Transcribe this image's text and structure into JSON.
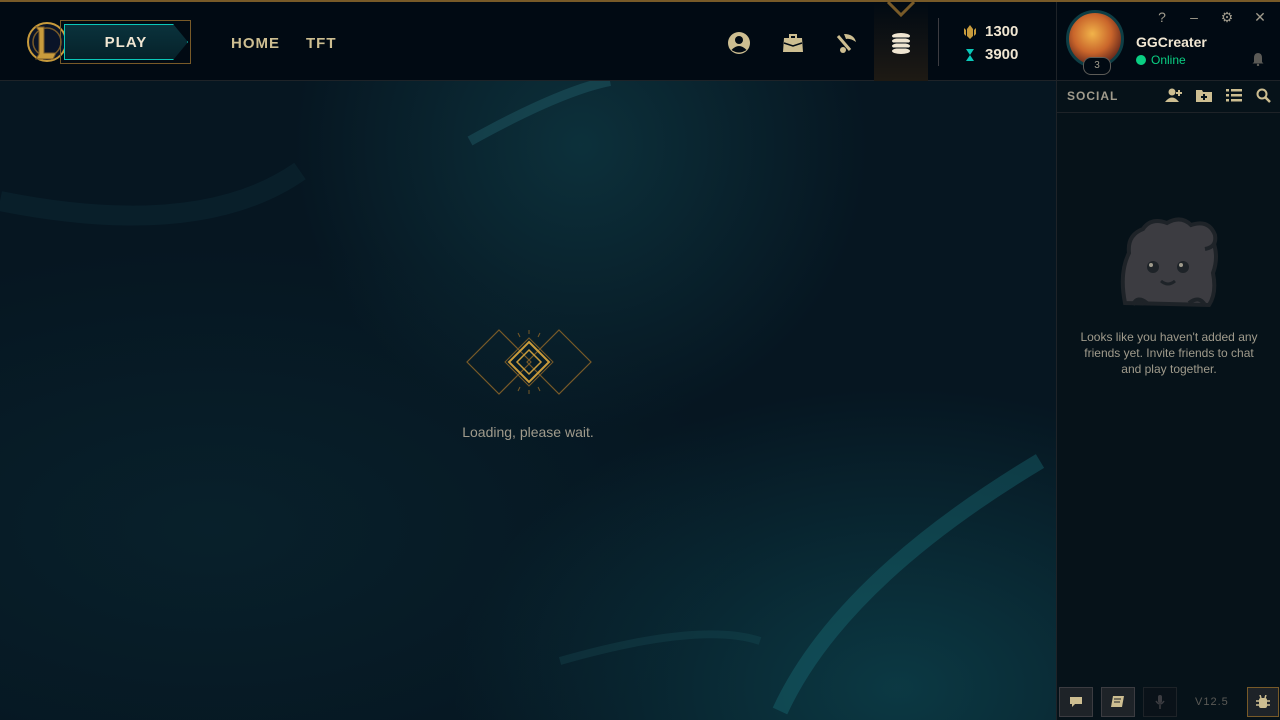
{
  "nav": {
    "play_label": "PLAY",
    "home_label": "HOME",
    "tft_label": "TFT",
    "icons": [
      "profile-icon",
      "collection-icon",
      "loot-icon",
      "store-icon"
    ]
  },
  "wallet": {
    "blue_essence": "1300",
    "riot_points": "3900"
  },
  "profile": {
    "username": "GGCreater",
    "status": "Online",
    "level": "3"
  },
  "window_controls": {
    "help": "?",
    "minimize": "–",
    "settings": "⚙",
    "close": "✕"
  },
  "main": {
    "loading_text": "Loading, please wait."
  },
  "social": {
    "title": "SOCIAL",
    "empty_message": "Looks like you haven't added any friends yet. Invite friends to chat and play together.",
    "version": "V12.5"
  },
  "colors": {
    "gold": "#cdbe91",
    "gold_dark": "#785a28",
    "teal": "#0ac8b9",
    "online": "#0acf83",
    "background": "#010a13"
  }
}
